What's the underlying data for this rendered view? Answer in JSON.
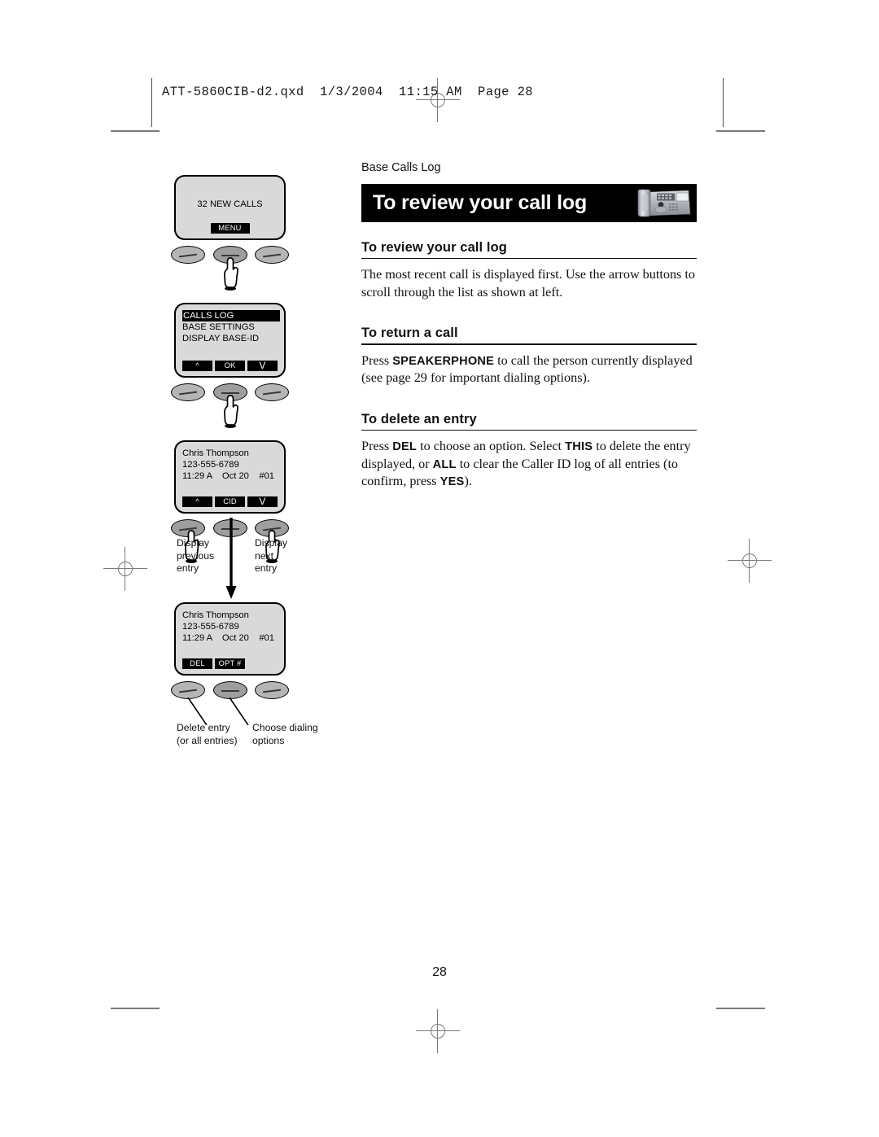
{
  "document": {
    "header_line": "ATT-5860CIB-d2.qxd  1/3/2004  11:15 AM  Page 28",
    "page_number": "28"
  },
  "content": {
    "kicker": "Base Calls Log",
    "banner_title": "To review your call log",
    "banner_icon": "phone-base-unit-icon",
    "sections": [
      {
        "heading": "To review your call log",
        "body_html": "The most recent call is displayed first. Use the arrow buttons to scroll through the list as shown at left."
      },
      {
        "heading": "To return a call",
        "body_html": "Press <b>SPEAKERPHONE</b> to call the person currently displayed (see page 29 for important dialing options)."
      },
      {
        "heading": "To delete an entry",
        "body_html": "Press <b>DEL</b> to choose an option. Select <b>THIS</b> to delete the entry displayed, or <b>ALL</b> to clear the Caller ID log of all entries (to confirm, press <b>YES</b>)."
      }
    ]
  },
  "illustration": {
    "screens": [
      {
        "id": "screen-new-calls",
        "lines": [
          "32 NEW CALLS"
        ],
        "softkeys": [
          "MENU"
        ]
      },
      {
        "id": "screen-menu-list",
        "lines": [
          "CALLS LOG",
          "BASE SETTINGS",
          "DISPLAY BASE-ID"
        ],
        "highlight_index": 0,
        "softkeys": [
          "^",
          "OK",
          "V"
        ]
      },
      {
        "id": "screen-cid-entry",
        "lines": [
          "Chris Thompson",
          "123-555-6789",
          "11:29 A    Oct 20    #01"
        ],
        "softkeys": [
          "^",
          "CID",
          "V"
        ]
      },
      {
        "id": "screen-cid-delete",
        "lines": [
          "Chris Thompson",
          "123-555-6789",
          "11:29 A    Oct 20    #01"
        ],
        "softkeys": [
          "DEL",
          "OPT #"
        ]
      }
    ],
    "captions": {
      "display_previous": "Display\nprevious\nentry",
      "display_next": "Display\nnext\nentry",
      "delete_entry": "Delete entry\n(or all entries)",
      "choose_dialing": "Choose dialing\noptions"
    }
  }
}
